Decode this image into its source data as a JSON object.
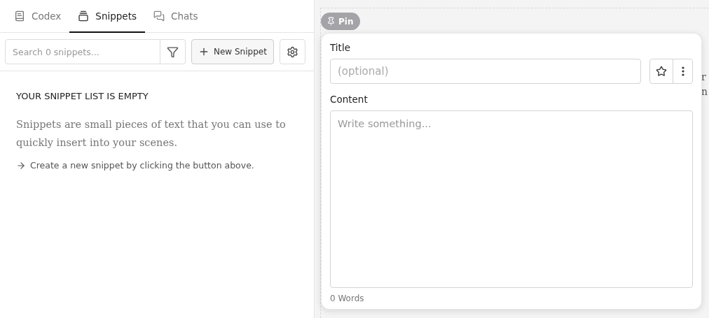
{
  "tabs": [
    {
      "label": "Codex",
      "selected": false
    },
    {
      "label": "Snippets",
      "selected": true
    },
    {
      "label": "Chats",
      "selected": false
    }
  ],
  "search": {
    "placeholder": "Search 0 snippets..."
  },
  "new_button": "New Snippet",
  "empty_state": {
    "heading": "YOUR SNIPPET LIST IS EMPTY",
    "description": "Snippets are small pieces of text that you can use to quickly insert into your scenes.",
    "hint": "Create a new snippet by clicking the button above."
  },
  "background_text": [
    "r",
    "n"
  ],
  "pin_button": "Pin",
  "editor": {
    "title_label": "Title",
    "title_placeholder": "(optional)",
    "starred": false,
    "content_label": "Content",
    "content_placeholder": "Write something...",
    "word_count": "0 Words"
  }
}
